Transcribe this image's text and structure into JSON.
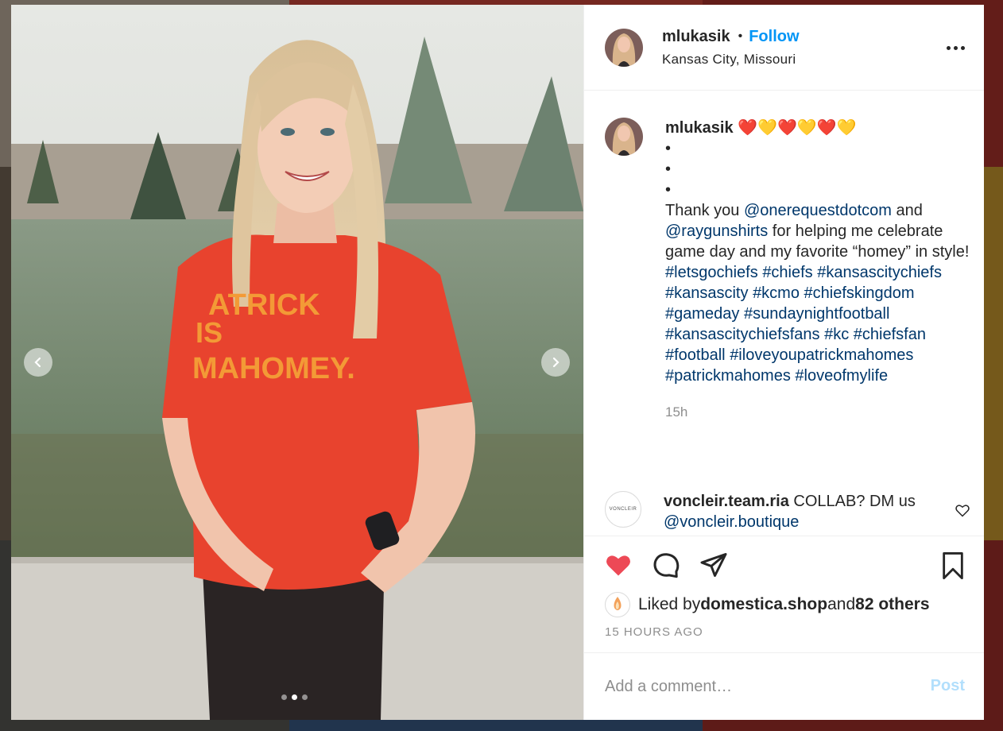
{
  "colors": {
    "accent": "#0095f6",
    "link": "#00376b",
    "like_red": "#ed4956",
    "muted": "#8e8e8e"
  },
  "post": {
    "author": "mlukasik",
    "separator": "•",
    "follow_label": "Follow",
    "location": "Kansas City, Missouri",
    "more_icon": "more-horizontal-icon",
    "photo": {
      "shirt_text_line1": "ATRICK",
      "shirt_text_line2": "IS",
      "shirt_text_line3": "MAHOMEY."
    },
    "carousel": {
      "active_index": 1,
      "count": 3
    }
  },
  "caption": {
    "user": "mlukasik",
    "emojis": "❤️💛❤️💛❤️💛",
    "bullets": [
      "•",
      "•",
      "•"
    ],
    "text_before": "Thank you ",
    "mention1": "@onerequestdotcom",
    "text_mid": " and ",
    "mention2": "@raygunshirts",
    "text_after": " for helping me celebrate game day and my favorite “homey” in style!",
    "hashtags": [
      "#letsgochiefs",
      "#chiefs",
      "#kansascitychiefs",
      "#kansascity",
      "#kcmo",
      "#chiefskingdom",
      "#gameday",
      "#sundaynightfootball",
      "#kansascitychiefsfans",
      "#kc",
      "#chiefsfan",
      "#football",
      "#iloveyoupatrickmahomes",
      "#patrickmahomes",
      "#loveofmylife"
    ],
    "time": "15h"
  },
  "comment": {
    "user": "voncleir.team.ria",
    "text": " COLLAB? DM us ",
    "mention": "@voncleir.boutique",
    "avatar_text": "VONCLEIR"
  },
  "actions": {
    "liked_prefix": "Liked by ",
    "liked_user": "domestica.shop",
    "liked_and": " and ",
    "liked_others": "82 others",
    "timestamp": "15 HOURS AGO"
  },
  "add_comment": {
    "placeholder": "Add a comment…",
    "post_label": "Post"
  }
}
